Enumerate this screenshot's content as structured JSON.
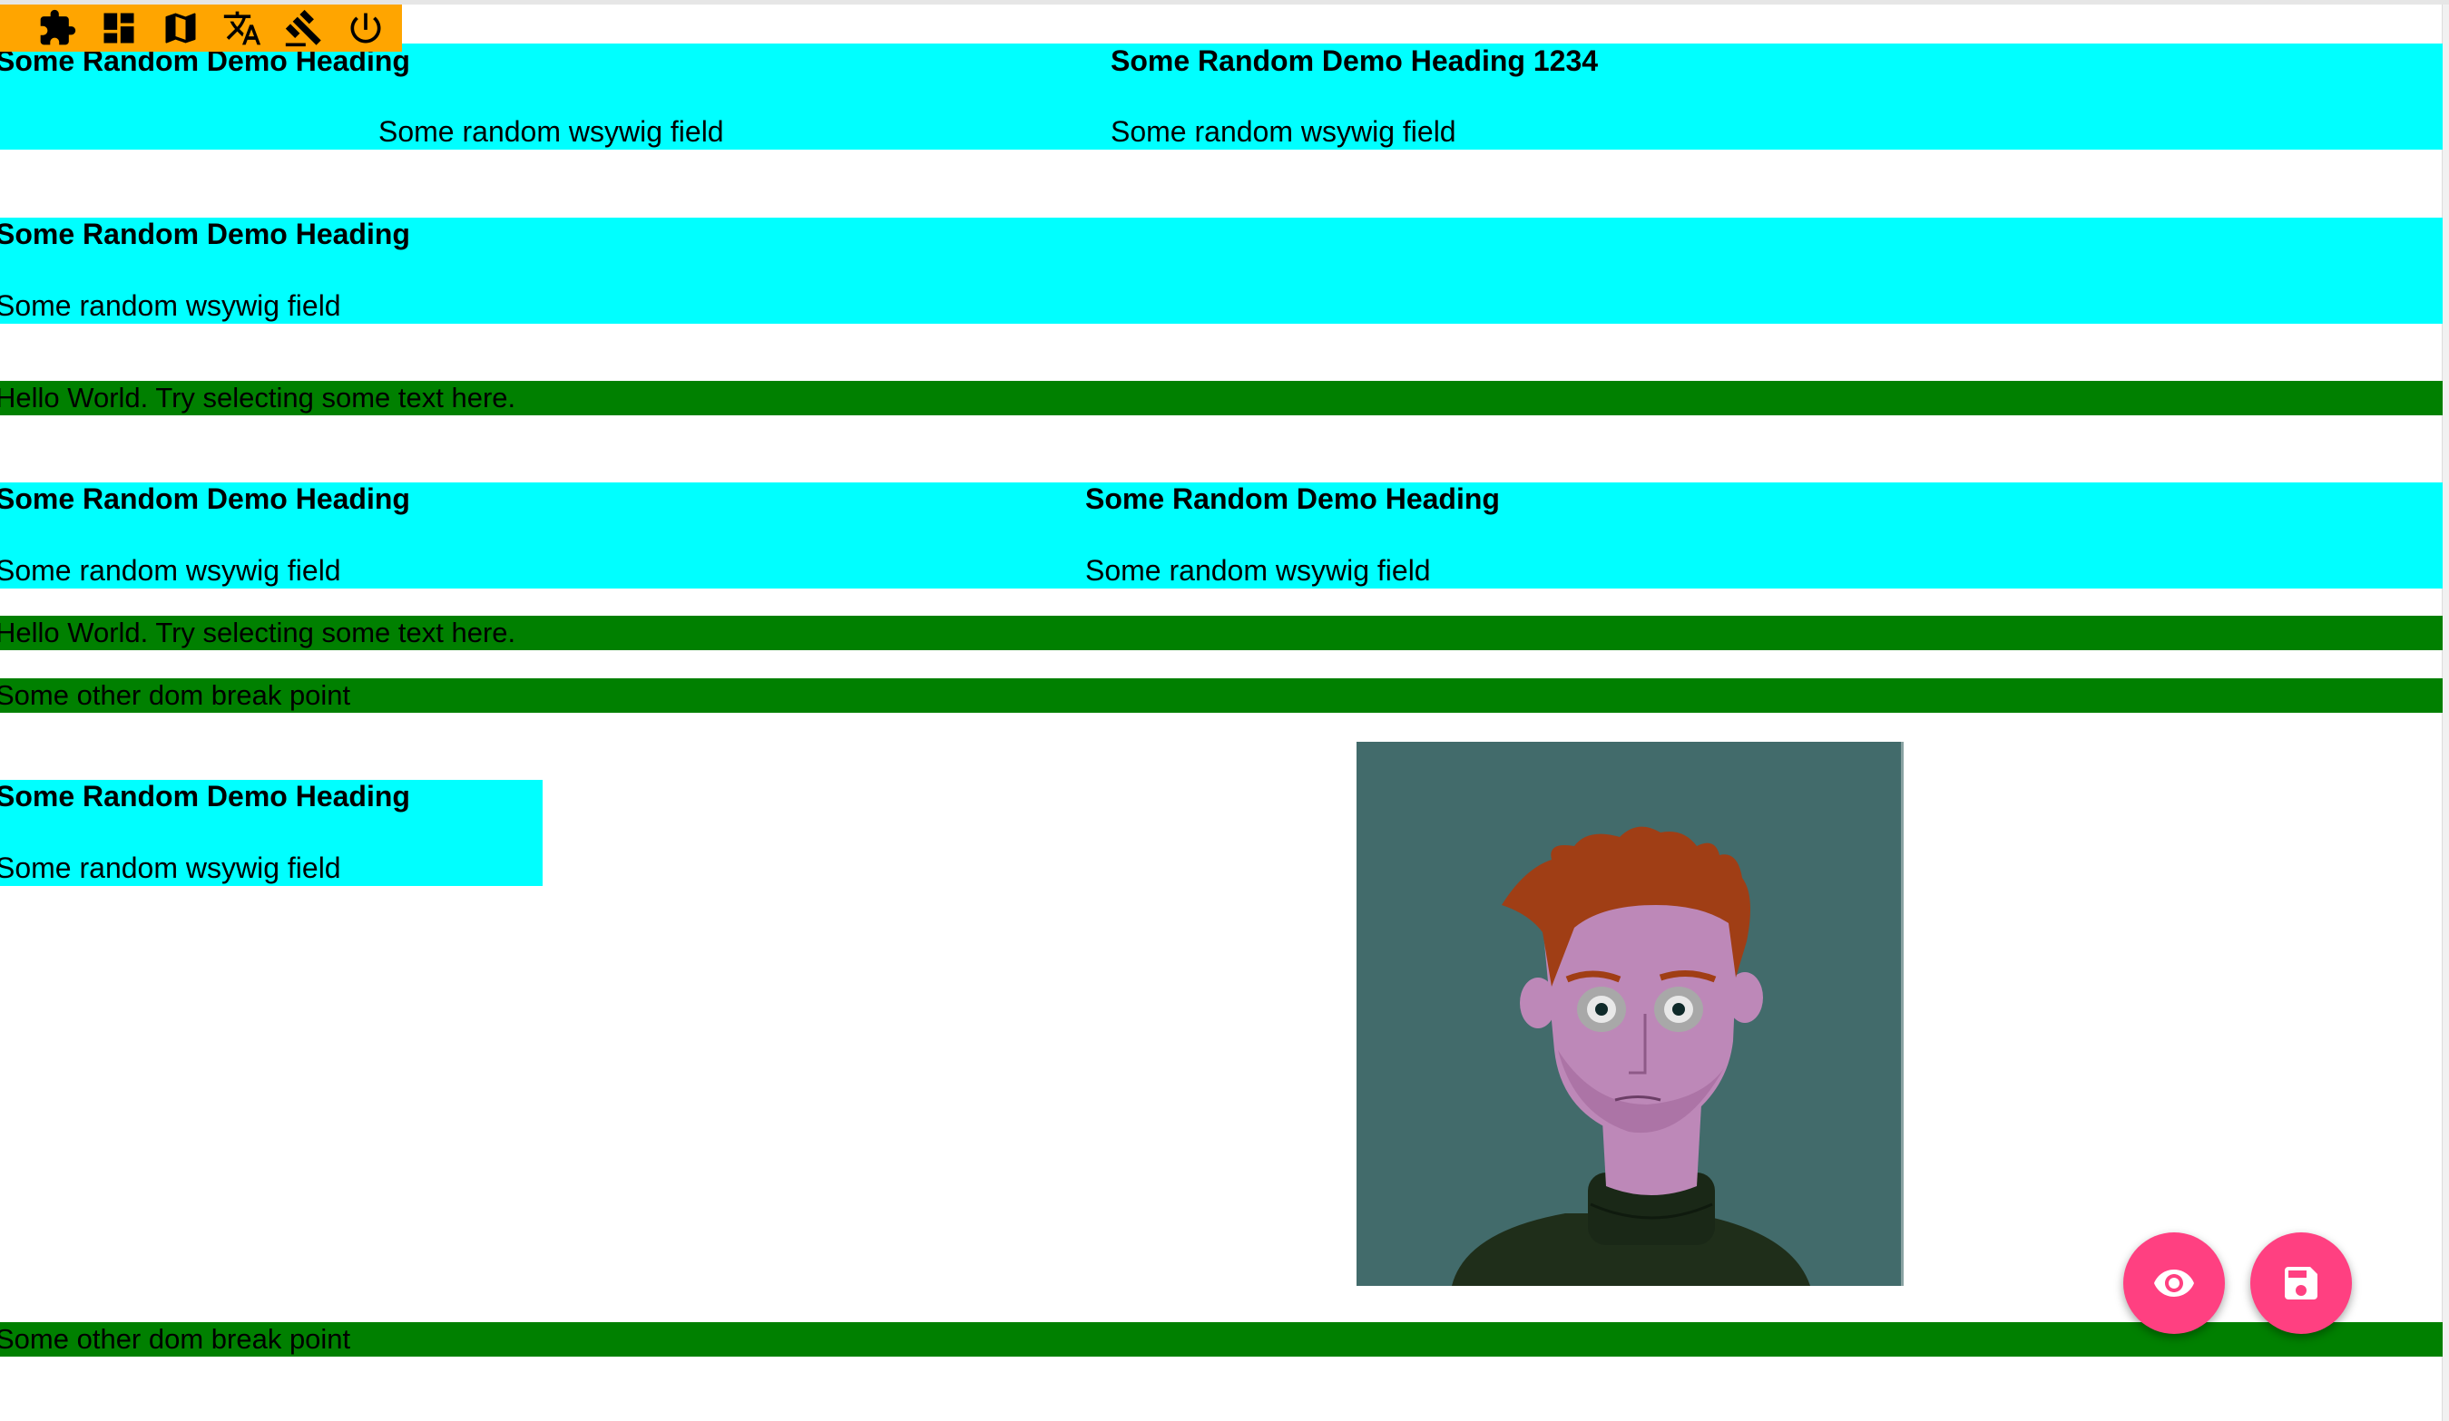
{
  "toolbar": {
    "icons": [
      "puzzle-icon",
      "dashboard-icon",
      "map-icon",
      "translate-icon",
      "gavel-icon",
      "power-icon"
    ],
    "background": "#ffa500"
  },
  "colors": {
    "block_bg": "#00ffff",
    "break_bg": "#008000",
    "fab_bg": "#ff4081"
  },
  "section1": {
    "col1": {
      "heading": "Some Random Demo Heading",
      "field": "Some random wsywig field"
    },
    "col2": {
      "heading": "Some Random Demo Heading 1234",
      "field": "Some random wsywig field"
    }
  },
  "section2": {
    "heading": "Some Random Demo Heading",
    "field": "Some random wsywig field"
  },
  "break1": "Hello World. Try selecting some text here.",
  "section3": {
    "col1": {
      "heading": "Some Random Demo Heading",
      "field": "Some random wsywig field"
    },
    "col2": {
      "heading": "Some Random Demo Heading",
      "field": "Some random wsywig field"
    }
  },
  "break2": "Hello World. Try selecting some text here.",
  "break3": "Some other dom break point",
  "section4": {
    "heading": "Some Random Demo Heading",
    "field": "Some random wsywig field"
  },
  "portrait": {
    "icon": "portrait-illustration"
  },
  "break4": "Some other dom break point",
  "fabs": {
    "preview": "eye-icon",
    "save": "save-icon"
  }
}
